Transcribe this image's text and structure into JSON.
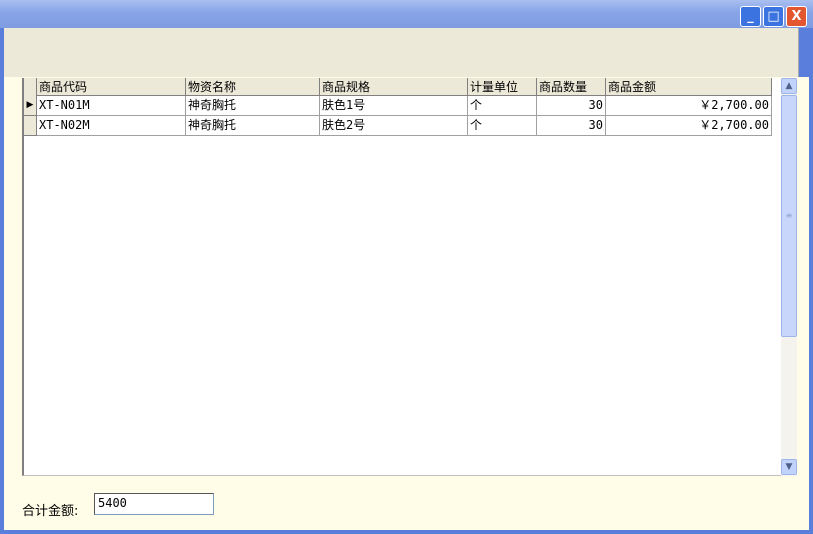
{
  "window": {
    "minimize": "_",
    "maximize": "□",
    "close": "X"
  },
  "grid": {
    "columns": [
      "商品代码",
      "物资名称",
      "商品规格",
      "计量单位",
      "商品数量",
      "商品金额"
    ],
    "rows": [
      [
        "XT-N01M",
        "神奇胸托",
        "肤色1号",
        "个",
        "30",
        "￥2,700.00"
      ],
      [
        "XT-N02M",
        "神奇胸托",
        "肤色2号",
        "个",
        "30",
        "￥2,700.00"
      ]
    ],
    "current_row_marker": "▶"
  },
  "footer": {
    "total_label": "合计金额:",
    "total_value": "5400"
  }
}
